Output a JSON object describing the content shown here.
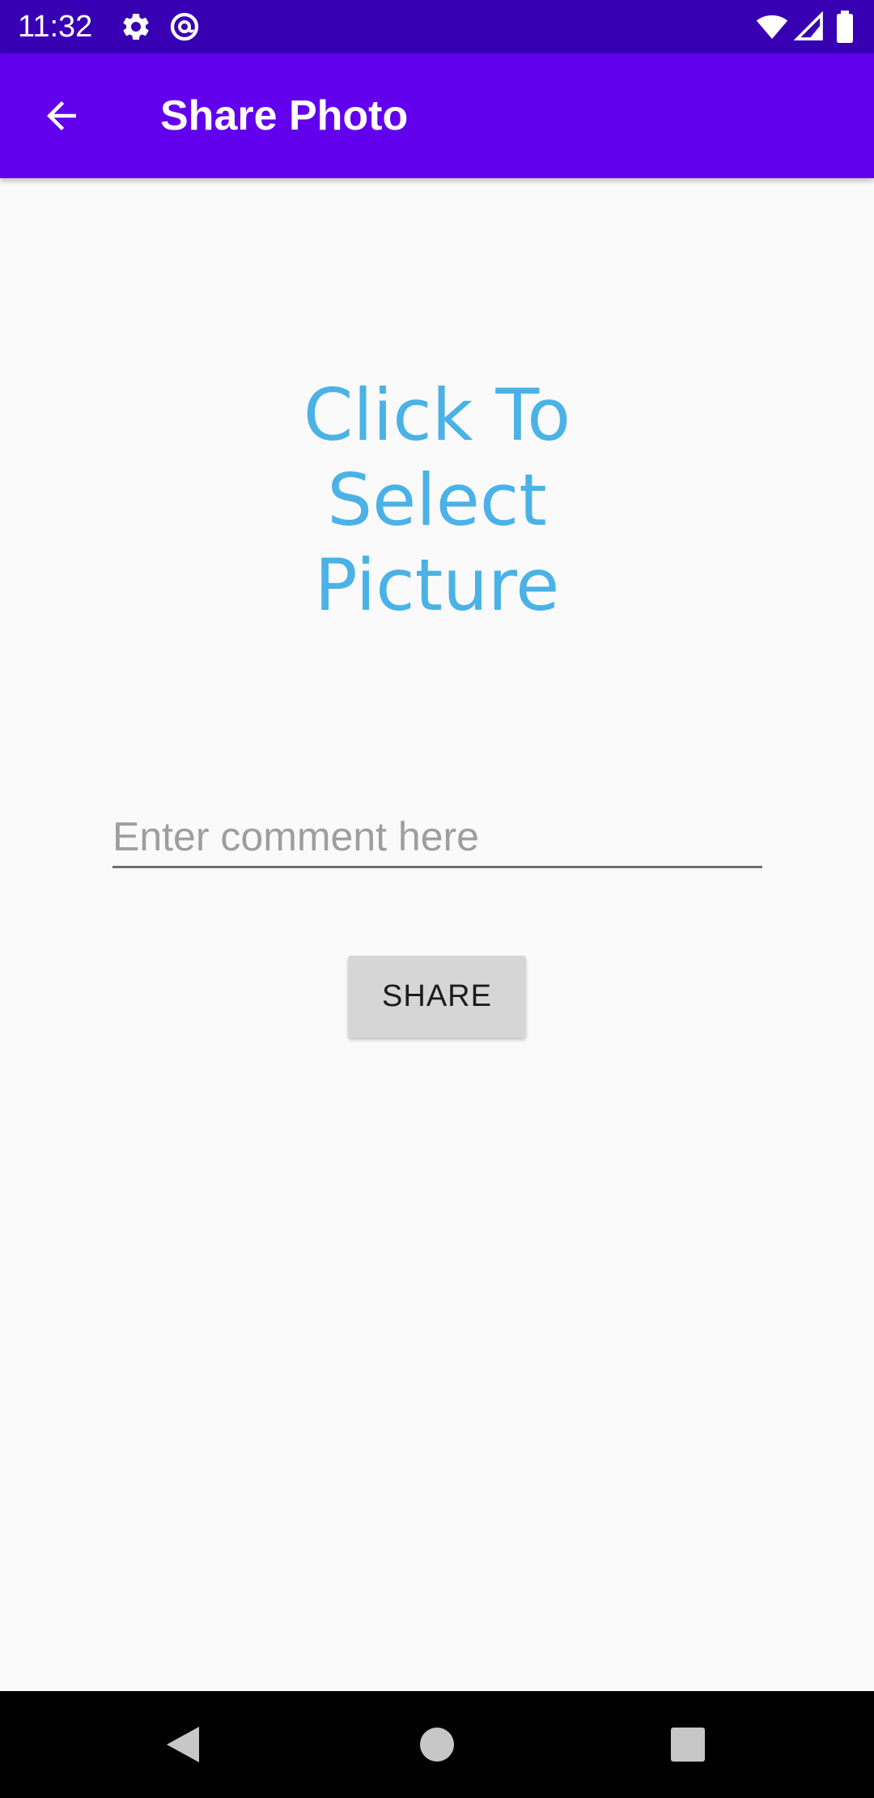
{
  "status_bar": {
    "time": "11:32",
    "icons": [
      "gear-icon",
      "at-sign-icon",
      "wifi-icon",
      "cellular-signal-icon",
      "battery-icon"
    ]
  },
  "app_bar": {
    "title": "Share Photo",
    "back_icon": "arrow-back-icon"
  },
  "main": {
    "select_picture_line1": "Click To",
    "select_picture_line2": "Select",
    "select_picture_line3": "Picture",
    "comment_placeholder": "Enter comment here",
    "comment_value": "",
    "share_label": "SHARE"
  },
  "nav_bar": {
    "icons": [
      "back-triangle-icon",
      "home-circle-icon",
      "recents-square-icon"
    ]
  },
  "colors": {
    "status_bar": "#3700b3",
    "app_bar": "#6200ee",
    "select_text": "#4ab2e6",
    "button_bg": "#d6d6d6"
  }
}
